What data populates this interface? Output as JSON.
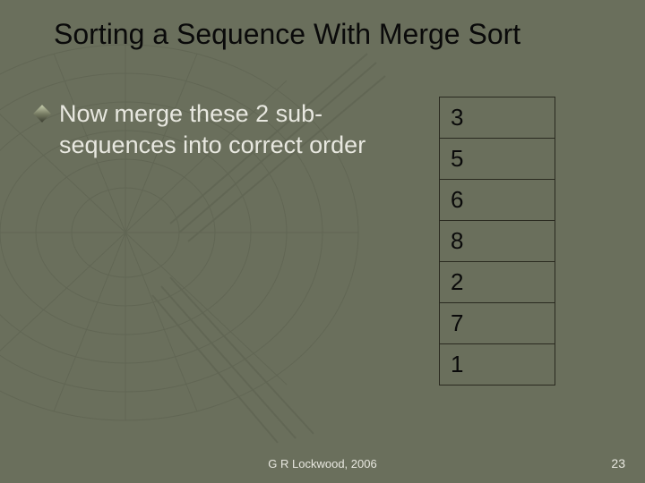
{
  "title": "Sorting a Sequence With Merge Sort",
  "bullet": "Now merge these 2 sub-sequences into correct order",
  "table": [
    "3",
    "5",
    "6",
    "8",
    "2",
    "7",
    "1"
  ],
  "footer": "G R Lockwood, 2006",
  "pagenum": "23"
}
